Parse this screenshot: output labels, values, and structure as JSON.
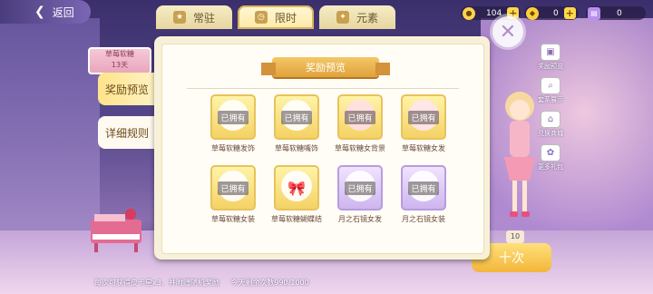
{
  "topbar": {
    "back_label": "返回",
    "tabs": [
      {
        "label": "常驻",
        "icon": "star-tag-icon",
        "active": false
      },
      {
        "label": "限时",
        "icon": "timer-icon",
        "active": true
      },
      {
        "label": "元素",
        "icon": "element-icon",
        "active": false
      }
    ],
    "currencies": [
      {
        "icon": "coin-icon",
        "value": "104"
      },
      {
        "icon": "diamond-icon",
        "value": "0"
      },
      {
        "icon": "ticket-icon",
        "value": "0"
      }
    ]
  },
  "sidebar": {
    "banner_title": "草莓软糖",
    "banner_days": "13天",
    "tabs": [
      {
        "label": "奖励预览",
        "active": true
      },
      {
        "label": "详细规则",
        "active": false
      }
    ]
  },
  "right_menu": [
    {
      "label": "奖励预览",
      "icon": "gift-box-icon"
    },
    {
      "label": "套系展示",
      "icon": "search-icon"
    },
    {
      "label": "兑换商城",
      "icon": "shop-icon"
    },
    {
      "label": "更多礼包",
      "icon": "gift-icon"
    }
  ],
  "modal": {
    "title": "奖励预览",
    "items": [
      {
        "name": "草莓软糖发饰",
        "owned": true,
        "owned_label": "已拥有",
        "tier": "gold"
      },
      {
        "name": "草莓软糖嘴饰",
        "owned": true,
        "owned_label": "已拥有",
        "tier": "gold"
      },
      {
        "name": "草莓软糖女背景",
        "owned": true,
        "owned_label": "已拥有",
        "tier": "gold"
      },
      {
        "name": "草莓软糖女发",
        "owned": true,
        "owned_label": "已拥有",
        "tier": "gold"
      },
      {
        "name": "草莓软糖女装",
        "owned": true,
        "owned_label": "已拥有",
        "tier": "gold"
      },
      {
        "name": "草莓软糖蝴蝶结",
        "owned": false,
        "owned_label": "",
        "tier": "gold"
      },
      {
        "name": "月之石镜女发",
        "owned": true,
        "owned_label": "已拥有",
        "tier": "purple"
      },
      {
        "name": "月之石镜女装",
        "owned": true,
        "owned_label": "已拥有",
        "tier": "purple"
      }
    ]
  },
  "draw": {
    "count": "10",
    "button_label": "十次"
  },
  "footer": {
    "note": "每次可获得皮卡星x3，并附赠随机奖励",
    "remaining": "今天剩余次数990/1000"
  }
}
